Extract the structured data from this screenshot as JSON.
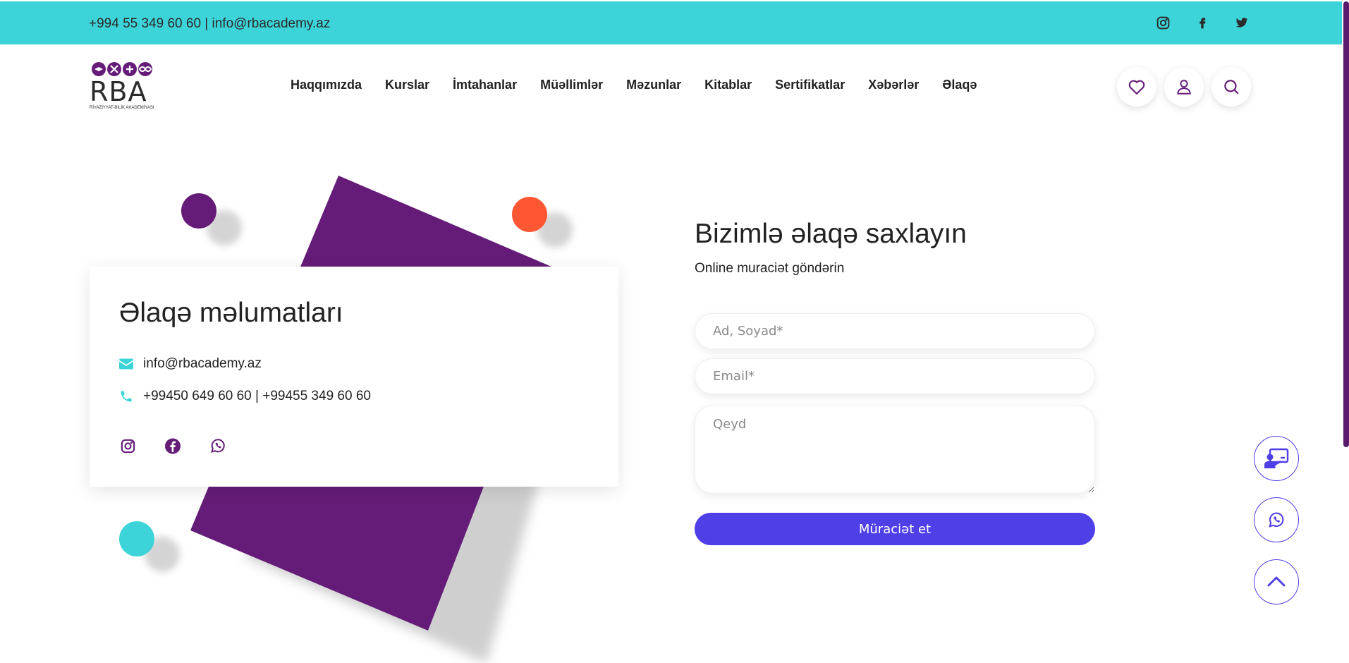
{
  "topbar": {
    "contact_text": "+994 55 349 60 60 | info@rbacademy.az",
    "social_icons": [
      "instagram-icon",
      "facebook-icon",
      "twitter-icon"
    ]
  },
  "logo": {
    "initials": "RBA",
    "tagline": "RİYAZİYYAT-BİLİK AKADEMİYASI"
  },
  "nav": {
    "items": [
      "Haqqımızda",
      "Kurslar",
      "İmtahanlar",
      "Müəllimlər",
      "Məzunlar",
      "Kitablar",
      "Sertifikatlar",
      "Xəbərlər",
      "Əlaqə"
    ]
  },
  "header_icons": [
    "heart-icon",
    "user-icon",
    "search-icon"
  ],
  "contact_card": {
    "title": "Əlaqə məlumatları",
    "email": "info@rbacademy.az",
    "phones": "+99450 649 60 60 | +99455 349 60 60",
    "social_icons": [
      "instagram-icon",
      "facebook-icon",
      "whatsapp-icon"
    ]
  },
  "form": {
    "title": "Bizimlə əlaqə saxlayın",
    "subtitle": "Online muraciət göndərin",
    "name_placeholder": "Ad, Soyad*",
    "email_placeholder": "Email*",
    "note_placeholder": "Qeyd",
    "submit_label": "Müraciət et"
  },
  "floating_buttons": [
    "online-lesson-icon",
    "whatsapp-icon",
    "chevron-up-icon"
  ],
  "colors": {
    "topbar": "#3dd4d9",
    "brand_purple": "#651c78",
    "accent_blue": "#4f3fe6",
    "decor_red": "#ff5733",
    "decor_teal": "#3dd4d9"
  }
}
